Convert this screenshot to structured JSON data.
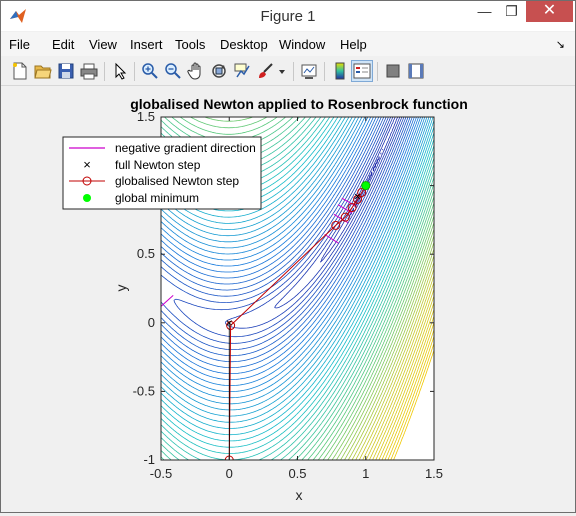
{
  "window": {
    "title": "Figure 1",
    "min_glyph": "—",
    "max_glyph": "❐",
    "close_glyph": "✕"
  },
  "menu": [
    "File",
    "Edit",
    "View",
    "Insert",
    "Tools",
    "Desktop",
    "Window",
    "Help"
  ],
  "menu_dock_glyph": "↘",
  "toolbar": [
    "new-figure",
    "open-file",
    "save",
    "print",
    "edit-plot-arrow",
    "zoom-in",
    "zoom-out",
    "pan",
    "rotate-3d",
    "data-cursor",
    "brush",
    "brush-dropdown",
    "link-plot",
    "insert-colorbar",
    "insert-legend",
    "hide-plot-tools",
    "show-plot-tools"
  ],
  "colors": {
    "newton_step": "#c00000",
    "gradient": "#cc00cc",
    "minimum": "#00ff00",
    "contour_low": "#2f7fd0",
    "contour_high": "#e8c000"
  },
  "chart_data": {
    "type": "contour",
    "title": "globalised Newton applied to Rosenbrock function",
    "xlabel": "x",
    "ylabel": "y",
    "xlim": [
      -0.5,
      1.5
    ],
    "ylim": [
      -1,
      1.5
    ],
    "xticks": [
      "-0.5",
      "0",
      "0.5",
      "1",
      "1.5"
    ],
    "yticks": [
      "-1",
      "-0.5",
      "0",
      "0.5",
      "1",
      "1.5"
    ],
    "legend": {
      "placement": "top-left",
      "entries": [
        "negative gradient direction",
        "full Newton step",
        "globalised Newton step",
        "global minimum"
      ]
    },
    "full_newton_steps": [
      [
        0,
        0
      ],
      [
        0.94,
        0.92
      ]
    ],
    "globalised_newton_path": [
      [
        0,
        -1
      ],
      [
        0.01,
        -0.02
      ],
      [
        0.78,
        0.71
      ],
      [
        0.85,
        0.77
      ],
      [
        0.9,
        0.84
      ],
      [
        0.94,
        0.9
      ],
      [
        0.97,
        0.95
      ],
      [
        1.0,
        1.0
      ]
    ],
    "gradient_start": [
      -0.5,
      0.12
    ],
    "global_minimum": [
      1,
      1
    ]
  }
}
